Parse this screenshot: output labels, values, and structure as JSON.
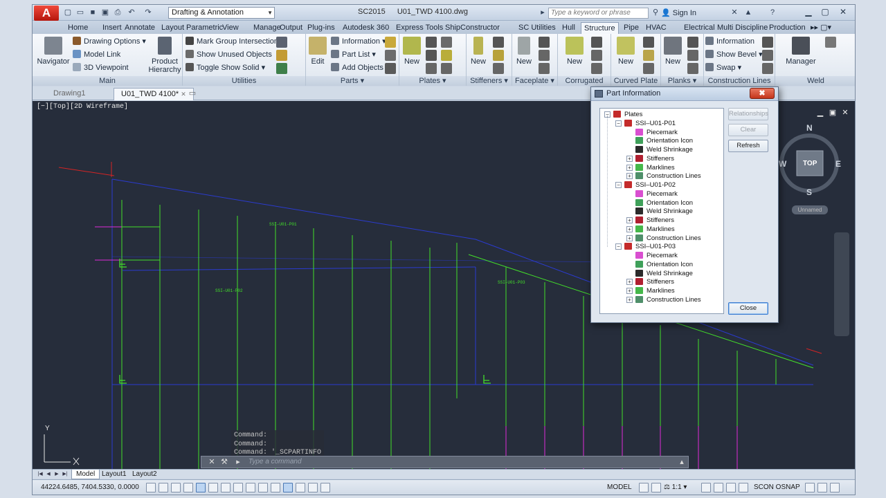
{
  "title_bar": {
    "app_logo": "A",
    "workspace": "Drafting & Annotation",
    "title_prefix": "SC2015",
    "title_file": "U01_TWD 4100.dwg",
    "search_placeholder": "Type a keyword or phrase",
    "sign_in": "Sign In"
  },
  "tabs": [
    "Home",
    "Insert",
    "Annotate",
    "Layout",
    "Parametric",
    "View",
    "Manage",
    "Output",
    "Plug-ins",
    "Autodesk 360",
    "Express Tools",
    "ShipConstructor",
    "SC Utilities",
    "Hull",
    "Structure",
    "Pipe",
    "HVAC",
    "Electrical",
    "Multi Discipline",
    "Production"
  ],
  "active_tab": "Structure",
  "ribbon": {
    "main": {
      "title": "Main",
      "navigator": "Navigator",
      "drawing_options": "Drawing Options",
      "model_link": "Model Link",
      "viewpoint": "3D Viewpoint",
      "product_hierarchy": "Product Hierarchy"
    },
    "utilities": {
      "title": "Utilities",
      "mark_group": "Mark Group Intersections",
      "show_unused": "Show Unused Objects",
      "toggle_solid": "Toggle Show Solid"
    },
    "parts": {
      "title": "Parts",
      "edit": "Edit",
      "information": "Information",
      "part_list": "Part List",
      "add_objects": "Add Objects"
    },
    "plates": {
      "title": "Plates",
      "new": "New"
    },
    "stiffeners": {
      "title": "Stiffeners",
      "new": "New"
    },
    "faceplate": {
      "title": "Faceplate",
      "new": "New"
    },
    "corrugated": {
      "title": "Corrugated Plate",
      "new": "New"
    },
    "curved": {
      "title": "Curved Plate",
      "new": "New"
    },
    "planks": {
      "title": "Planks",
      "new": "New"
    },
    "construction": {
      "title": "Construction Lines",
      "information": "Information",
      "show_bevel": "Show Bevel",
      "swap": "Swap"
    },
    "weld": {
      "title": "Weld",
      "manager": "Manager"
    }
  },
  "doc_tabs": [
    "Drawing1",
    "U01_TWD 4100*"
  ],
  "viewport": {
    "label": "[−][Top][2D Wireframe]",
    "compass": {
      "n": "N",
      "s": "S",
      "e": "E",
      "w": "W",
      "top": "TOP"
    },
    "ucs_unnamed": "Unnamed",
    "plate_labels": [
      "SSI–U01-P01",
      "SSI–U01-P02",
      "SSI–U01-P03"
    ],
    "y_axis": "Y"
  },
  "command": {
    "history": [
      "Command:",
      "Command:",
      "Command:  '_SCPARTINFO"
    ],
    "placeholder": "Type  a  command"
  },
  "layout_tabs": [
    "Model",
    "Layout1",
    "Layout2"
  ],
  "status_bar": {
    "coords": "44224.6485, 7404.5330, 0.0000",
    "model": "MODEL",
    "scale": "1:1",
    "scon_osnap": "SCON OSNAP"
  },
  "dialog": {
    "title": "Part Information",
    "close_x": "✖",
    "root": "Plates",
    "plates": [
      {
        "name": "SSI–U01-P01",
        "children": [
          "Piecemark",
          "Orientation Icon",
          "Weld Shrinkage",
          "Stiffeners",
          "Marklines",
          "Construction Lines"
        ]
      },
      {
        "name": "SSI–U01-P02",
        "children": [
          "Piecemark",
          "Orientation Icon",
          "Weld Shrinkage",
          "Stiffeners",
          "Marklines",
          "Construction Lines"
        ]
      },
      {
        "name": "SSI–U01-P03",
        "children": [
          "Piecemark",
          "Orientation Icon",
          "Weld Shrinkage",
          "Stiffeners",
          "Marklines",
          "Construction Lines"
        ]
      }
    ],
    "buttons": {
      "relationships": "Relationships",
      "clear": "Clear",
      "refresh": "Refresh",
      "close": "Close"
    }
  },
  "colors": {
    "accent_blue": "#1f3fc2",
    "green": "#43e02a",
    "magenta": "#e02ad8",
    "red": "#d62424"
  }
}
